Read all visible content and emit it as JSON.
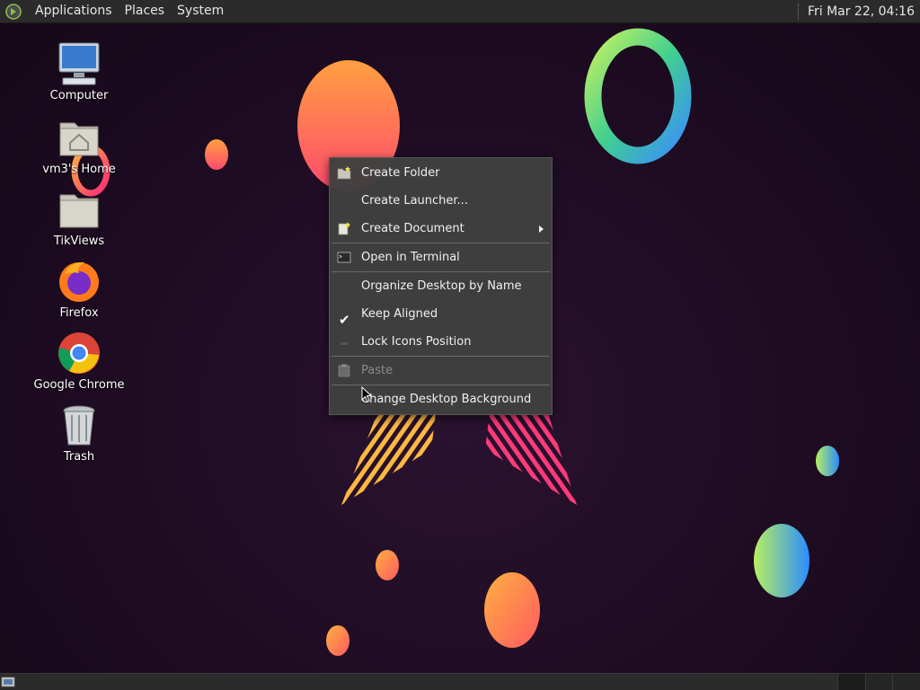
{
  "top_panel": {
    "menus": [
      "Applications",
      "Places",
      "System"
    ],
    "clock": "Fri Mar 22, 04:16"
  },
  "desktop_icons": [
    {
      "label": "Computer",
      "icon": "computer-icon"
    },
    {
      "label": "vm3's Home",
      "icon": "home-folder-icon"
    },
    {
      "label": "TikViews",
      "icon": "folder-icon"
    },
    {
      "label": "Firefox",
      "icon": "firefox-icon"
    },
    {
      "label": "Google Chrome",
      "icon": "chrome-icon"
    },
    {
      "label": "Trash",
      "icon": "trash-icon"
    }
  ],
  "context_menu": {
    "create_folder": "Create Folder",
    "create_launcher": "Create Launcher...",
    "create_document": "Create Document",
    "open_terminal": "Open in Terminal",
    "organize": "Organize Desktop by Name",
    "keep_aligned": "Keep Aligned",
    "keep_aligned_checked": true,
    "lock_icons": "Lock Icons Position",
    "paste": "Paste",
    "change_background": "Change Desktop Background"
  },
  "colors": {
    "panel_bg": "#2b2b2b",
    "menu_bg": "#404040",
    "desktop_bg": "#1f0d24"
  }
}
